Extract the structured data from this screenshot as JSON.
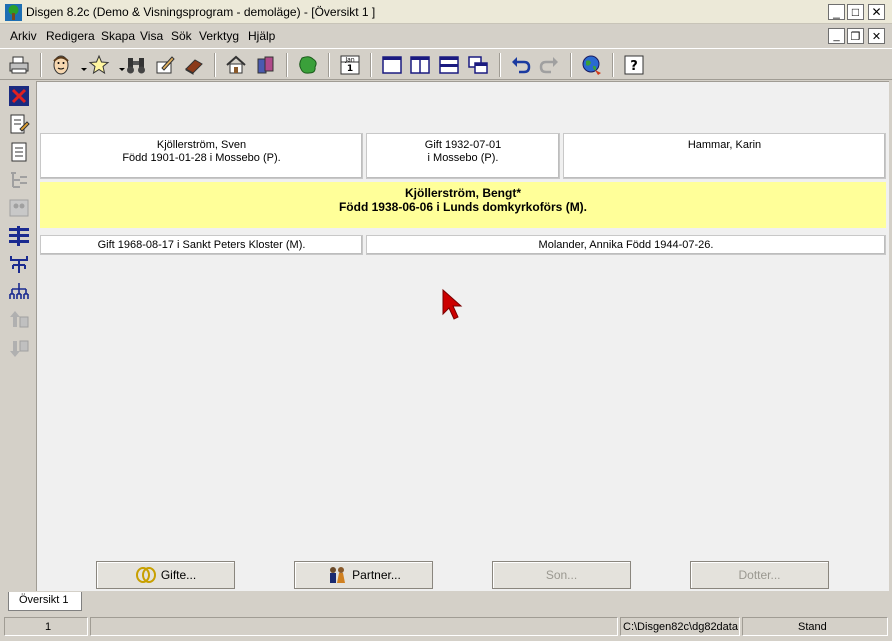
{
  "window": {
    "title": "Disgen 8.2c (Demo & Visningsprogram - demoläge) - [Översikt 1 ]",
    "minimize": "_",
    "maximize": "□",
    "close": "✕",
    "mdi_minimize": "_",
    "mdi_restore": "❐",
    "mdi_close": "✕"
  },
  "menu": [
    "Arkiv",
    "Redigera",
    "Skapa",
    "Visa",
    "Sök",
    "Verktyg",
    "Hjälp"
  ],
  "toolbar": {
    "calendar_month": "Jan",
    "calendar_day": "1",
    "help_glyph": "?"
  },
  "father": {
    "name": "Kjöllerström, Sven",
    "birth": "Född 1901-01-28 i Mossebo (P)."
  },
  "parents_marriage": {
    "line1": "Gift 1932-07-01",
    "line2": "i Mossebo (P)."
  },
  "mother": {
    "name": "Hammar, Karin"
  },
  "focus": {
    "name": "Kjöllerström, Bengt*",
    "birth": "Född 1938-06-06 i Lunds domkyrkoförs (M)."
  },
  "marriage": {
    "text": "Gift 1968-08-17 i Sankt Peters Kloster (M)."
  },
  "spouse": {
    "text": "Molander, Annika Född 1944-07-26."
  },
  "buttons": {
    "gifte": "Gifte...",
    "partner": "Partner...",
    "son": "Son...",
    "dotter": "Dotter..."
  },
  "tabs": [
    "Översikt 1"
  ],
  "status": {
    "count": "1",
    "path": "C:\\Disgen82c\\dg82data",
    "mode": "Stand"
  },
  "colors": {
    "focus_background": "#ffff99",
    "panel_background": "#ffffff",
    "chrome": "#d4d0c8",
    "cursor": "#cc0000"
  }
}
